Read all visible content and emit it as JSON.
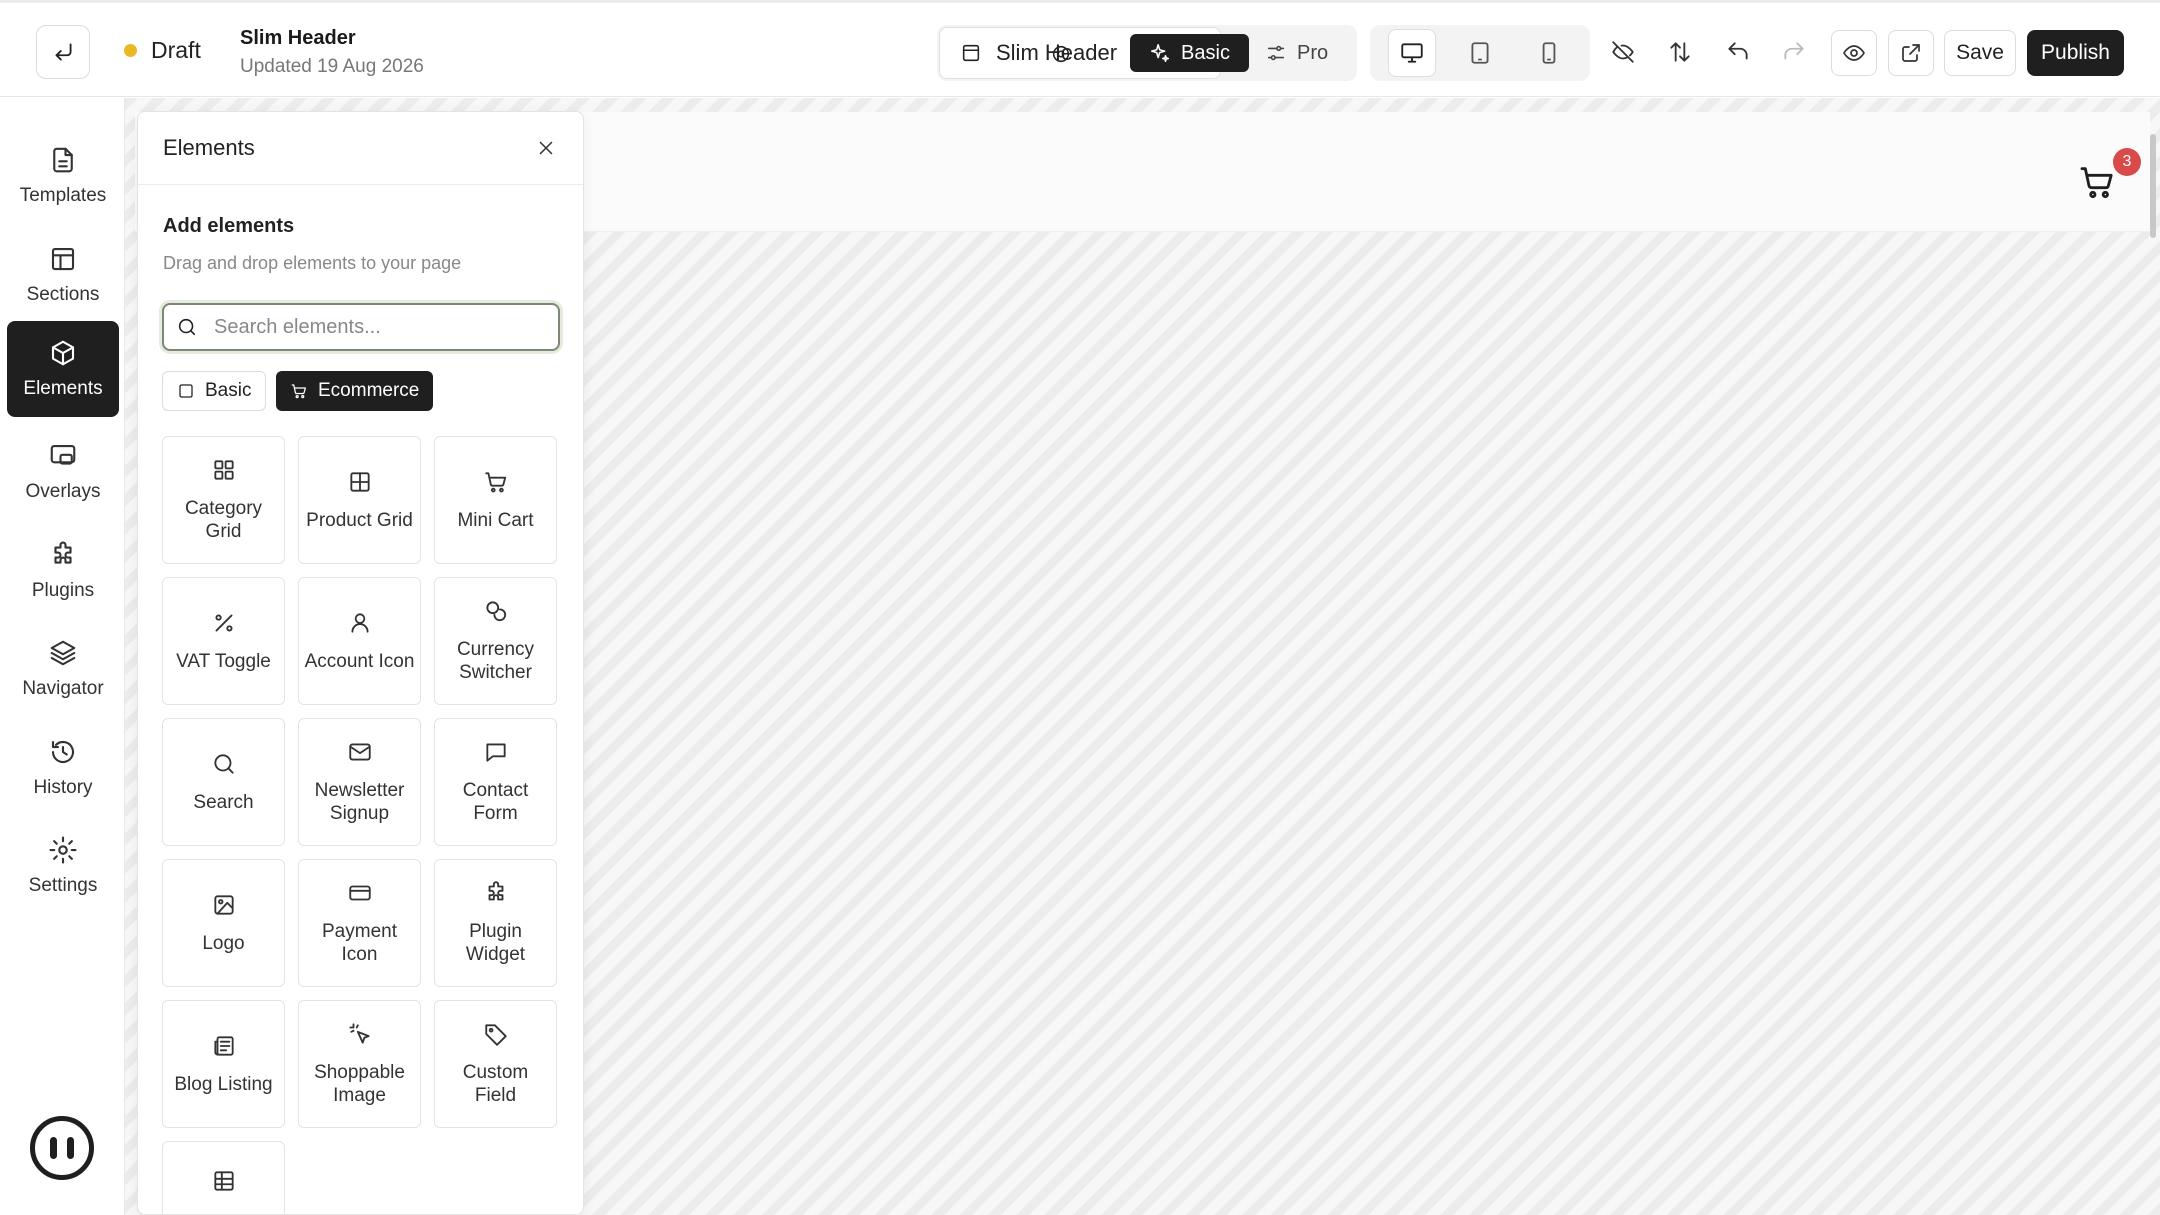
{
  "topbar": {
    "status": "Draft",
    "doc_title": "Slim Header",
    "updated": "Updated 19 Aug 2026",
    "section_selector": "Slim Header",
    "mode_basic": "Basic",
    "mode_pro": "Pro",
    "save_label": "Save",
    "publish_label": "Publish"
  },
  "rail": {
    "items": [
      {
        "label": "Templates",
        "icon": "document-icon"
      },
      {
        "label": "Sections",
        "icon": "layout-icon"
      },
      {
        "label": "Elements",
        "icon": "cube-icon",
        "active": true
      },
      {
        "label": "Overlays",
        "icon": "overlay-icon"
      },
      {
        "label": "Plugins",
        "icon": "puzzle-icon"
      },
      {
        "label": "Navigator",
        "icon": "layers-icon"
      },
      {
        "label": "History",
        "icon": "history-icon"
      },
      {
        "label": "Settings",
        "icon": "gear-icon"
      }
    ]
  },
  "panel": {
    "title": "Elements",
    "subtitle": "Add elements",
    "description": "Drag and drop elements to your page",
    "search_placeholder": "Search elements...",
    "filters": {
      "basic": "Basic",
      "ecommerce": "Ecommerce",
      "active": "Ecommerce"
    },
    "elements": [
      {
        "label": "Category Grid",
        "icon": "grid-icon"
      },
      {
        "label": "Product Grid",
        "icon": "table-grid-icon"
      },
      {
        "label": "Mini Cart",
        "icon": "cart-icon"
      },
      {
        "label": "VAT Toggle",
        "icon": "percent-icon"
      },
      {
        "label": "Account Icon",
        "icon": "user-icon"
      },
      {
        "label": "Currency Switcher",
        "icon": "coins-icon"
      },
      {
        "label": "Search",
        "icon": "search-icon"
      },
      {
        "label": "Newsletter Signup",
        "icon": "mail-icon"
      },
      {
        "label": "Contact Form",
        "icon": "message-icon"
      },
      {
        "label": "Logo",
        "icon": "image-icon"
      },
      {
        "label": "Payment Icon",
        "icon": "credit-card-icon"
      },
      {
        "label": "Plugin Widget",
        "icon": "puzzle-icon"
      },
      {
        "label": "Blog Listing",
        "icon": "newspaper-icon"
      },
      {
        "label": "Shoppable Image",
        "icon": "pointer-click-icon"
      },
      {
        "label": "Custom Field",
        "icon": "tag-icon"
      },
      {
        "label": "",
        "icon": "table-icon"
      }
    ]
  },
  "canvas": {
    "cart_count": "3"
  },
  "colors": {
    "accent_dark": "#1f1f1f",
    "draft_dot": "#e9b824",
    "badge": "#d94b4b"
  }
}
